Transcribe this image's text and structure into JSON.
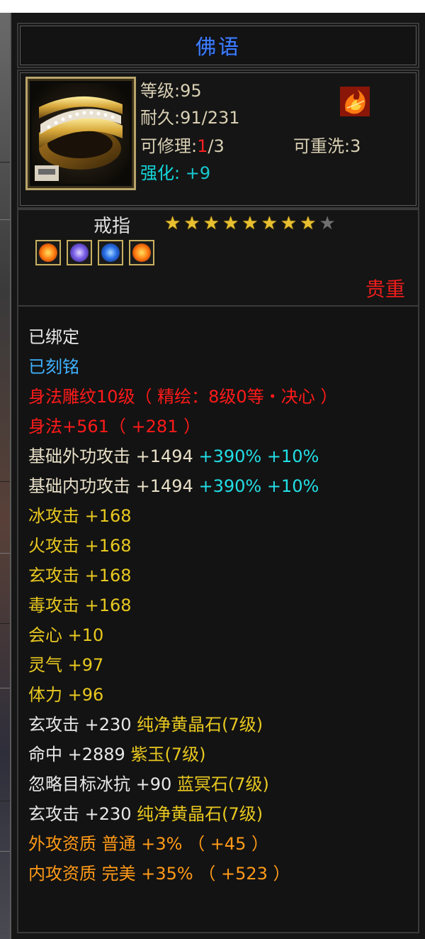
{
  "title": "佛语",
  "item": {
    "icon": "gold-diamond-ring-icon",
    "level_label": "等级:95",
    "durability_label": "耐久:91/231",
    "repair_prefix": "可修理:",
    "repair_used": "1",
    "repair_total": "/3",
    "rewash_label": "可重洗:3",
    "enhance_label": "强化:",
    "enhance_value": "+9",
    "status_icon": "flame-icon",
    "type": "戒指",
    "stars_filled": 8,
    "stars_total": 9,
    "gem_icons": [
      "fire-gem-icon",
      "purple-gem-icon",
      "blue-gem-icon",
      "fire-gem-icon"
    ],
    "rarity": "贵重"
  },
  "attributes": {
    "bound": "已绑定",
    "engraved": "已刻铭",
    "carving": "身法雕纹10级（ 精绘：8级0等・决心 ）",
    "agility": "身法+561（ +281 ）",
    "ext_attack_label": "基础外功攻击 +1494",
    "ext_attack_pct": " +390%",
    "ext_attack_bonus": " +10%",
    "int_attack_label": "基础内功攻击 +1494",
    "int_attack_pct": " +390%",
    "int_attack_bonus": " +10%",
    "ice": "冰攻击 +168",
    "fire": "火攻击 +168",
    "xuan": "玄攻击 +168",
    "poison": "毒攻击 +168",
    "crit": "会心 +10",
    "spirit": "灵气 +97",
    "stamina": "体力 +96",
    "gem1_stat": "玄攻击 +230",
    "gem1_name": " 纯净黄晶石(7级)",
    "gem2_stat": "命中 +2889",
    "gem2_name": " 紫玉(7级)",
    "gem3_stat": "忽略目标冰抗 +90",
    "gem3_name": " 蓝冥石(7级)",
    "gem4_stat": "玄攻击 +230",
    "gem4_name": " 纯净黄晶石(7级)",
    "ext_quality": "外攻资质  普通 +3% （ +45 ）",
    "int_quality": "内攻资质  完美 +35% （ +523 ）"
  },
  "colors": {
    "title": "#3f7fff",
    "bound": "#e8e8e8",
    "engraved": "#3fb2ff",
    "red": "#ff1a1a",
    "cyan": "#22dfe6",
    "yellow": "#e8c820",
    "orange": "#ff9a18"
  }
}
